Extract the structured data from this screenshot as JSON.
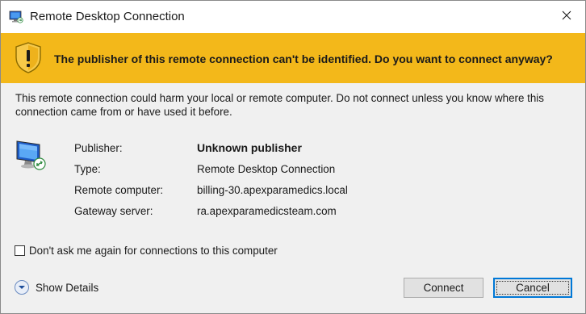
{
  "window": {
    "title": "Remote Desktop Connection"
  },
  "banner": {
    "text": "The publisher of this remote connection can't be identified. Do you want to connect anyway?"
  },
  "warning": {
    "text": "This remote connection could harm your local or remote computer. Do not connect unless you know where this connection came from or have used it before."
  },
  "details": [
    {
      "label": "Publisher:",
      "value": "Unknown publisher"
    },
    {
      "label": "Type:",
      "value": "Remote Desktop Connection"
    },
    {
      "label": "Remote computer:",
      "value": "billing-30.apexparamedics.local"
    },
    {
      "label": "Gateway server:",
      "value": "ra.apexparamedicsteam.com"
    }
  ],
  "checkbox": {
    "label": "Don't ask me again for connections to this computer",
    "checked": false
  },
  "show_details": {
    "label": "Show Details"
  },
  "buttons": {
    "connect": "Connect",
    "cancel": "Cancel"
  },
  "icons": {
    "app": "remote-desktop-icon",
    "close": "close-icon",
    "banner": "warning-shield-icon",
    "publisher": "remote-desktop-monitor-icon",
    "expand": "chevron-down-icon"
  },
  "colors": {
    "banner": "#f3b81a",
    "focus": "#0078d7"
  }
}
